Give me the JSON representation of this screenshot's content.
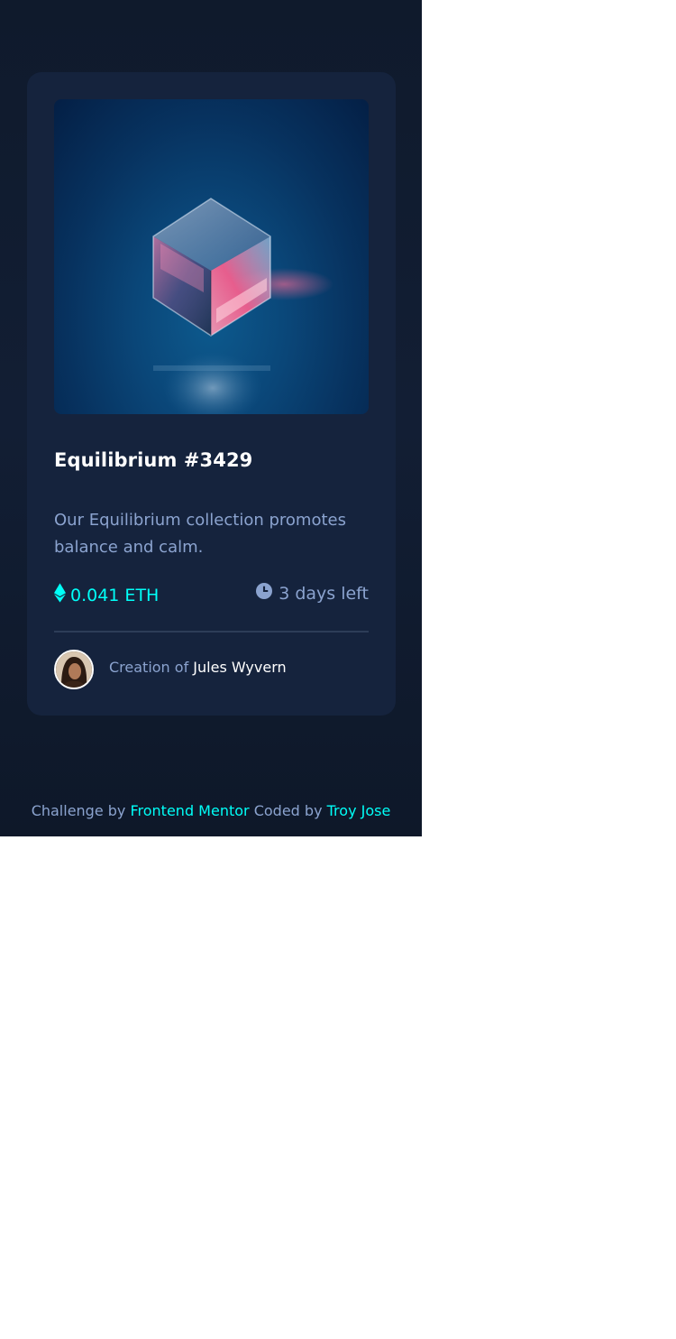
{
  "card": {
    "image_alt": "Equilibrium crystal cube",
    "title": "Equilibrium #3429",
    "description": "Our Equilibrium collection promotes balance and calm.",
    "price": "0.041 ETH",
    "time_left": "3 days left",
    "creator_prefix": "Creation of",
    "creator_name": "Jules Wyvern",
    "icons": {
      "price": "ethereum-icon",
      "time": "clock-icon"
    }
  },
  "footer": {
    "challenge_prefix": "Challenge by",
    "challenge_link": "Frontend Mentor",
    "coded_prefix": "Coded by",
    "coded_link": "Troy Jose"
  },
  "colors": {
    "page_bg": "#0f1a2c",
    "card_bg": "#15233d",
    "accent": "#00fff8",
    "muted": "#8ba3cf",
    "white": "#ffffff"
  }
}
